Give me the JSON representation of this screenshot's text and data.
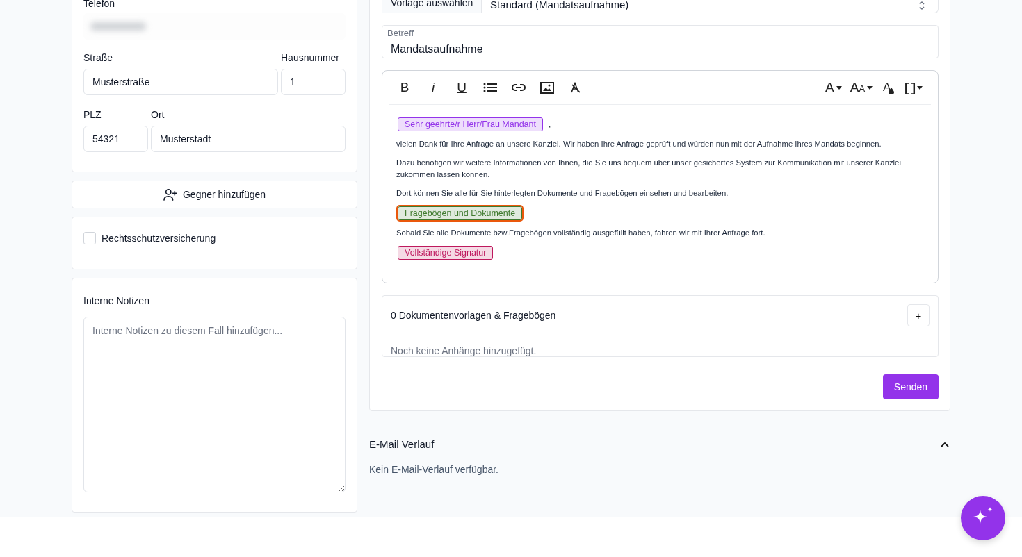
{
  "contact": {
    "phone_label": "Telefon",
    "street_label": "Straße",
    "street": "Musterstraße",
    "house_number_label": "Hausnummer",
    "house_number": "1",
    "zip_label": "PLZ",
    "zip": "54321",
    "city_label": "Ort",
    "city": "Musterstadt"
  },
  "add_opponent_button": "Gegner hinzufügen",
  "legal_insurance": {
    "label": "Rechtsschutzversicherung",
    "checked": false
  },
  "notes": {
    "label": "Interne Notizen",
    "placeholder": "Interne Notizen zu diesem Fall hinzufügen..."
  },
  "template": {
    "label": "Vorlage auswählen",
    "value": "Standard (Mandatsaufnahme)"
  },
  "subject": {
    "label": "Betreff",
    "value": "Mandatsaufnahme"
  },
  "editor": {
    "toolbar_left": [
      {
        "kind": "bold",
        "label": "B"
      },
      {
        "kind": "italic",
        "label": "i"
      },
      {
        "kind": "underline",
        "label": "U"
      },
      {
        "kind": "list"
      },
      {
        "kind": "link"
      },
      {
        "kind": "image"
      },
      {
        "kind": "clear-format"
      }
    ],
    "toolbar_right": [
      {
        "kind": "font",
        "label": "A"
      },
      {
        "kind": "font-size",
        "label": "A",
        "small_label": "A"
      },
      {
        "kind": "text-color",
        "label": "A"
      },
      {
        "kind": "placeholder",
        "label": "[ ]"
      }
    ],
    "body": [
      {
        "kind": "tag",
        "text": "Sehr geehrte/r Herr/Frau Mandant",
        "color": "#9333ea",
        "selected": false,
        "suffix": ","
      },
      {
        "kind": "text",
        "text": "vielen Dank für Ihre Anfrage an unsere Kanzlei. Wir haben Ihre Anfrage geprüft und würden nun mit der Aufnahme Ihres Mandats beginnen."
      },
      {
        "kind": "text",
        "text": "Dazu benötigen wir weitere Informationen von Ihnen, die Sie uns bequem über unser gesichertes System zur Kommunikation mit unserer Kanzlei zukommen lassen können."
      },
      {
        "kind": "text",
        "text": "Dort können Sie alle für Sie hinterlegten Dokumente und Fragebögen einsehen und bearbeiten."
      },
      {
        "kind": "tag",
        "text": "Fragebögen und Dokumente",
        "color": "#3f7a2e",
        "selected": true
      },
      {
        "kind": "text",
        "text": "Sobald Sie alle Dokumente bzw.Fragebögen vollständig ausgefüllt haben, fahren wir mit Ihrer Anfrage fort."
      },
      {
        "kind": "tag",
        "text": "Vollständige Signatur",
        "color": "#be185d",
        "selected": false
      }
    ]
  },
  "attachments": {
    "title": "0 Dokumentenvorlagen & Fragebögen",
    "add_button": "+",
    "empty_text": "Noch keine Anhänge hinzugefügt."
  },
  "send_button": "Senden",
  "email_history": {
    "title": "E-Mail Verlauf",
    "expanded": true,
    "empty_text": "Kein E-Mail-Verlauf verfügbar."
  }
}
